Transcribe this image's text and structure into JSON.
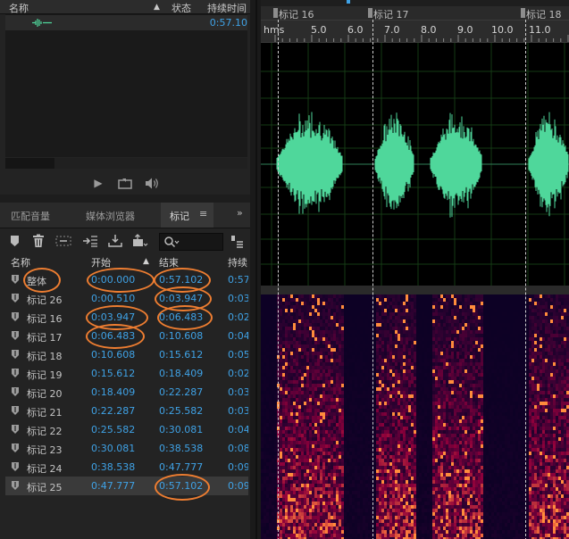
{
  "files_panel": {
    "columns": {
      "name": "名称",
      "status": "状态",
      "duration": "持续时间"
    },
    "file_duration": "0:57.10"
  },
  "markers_panel": {
    "tabs": [
      "匹配音量",
      "媒体浏览器",
      "标记"
    ],
    "active_tab": "标记",
    "columns": {
      "name": "名称",
      "start": "开始",
      "end": "结束",
      "duration": "持续"
    },
    "rows": [
      {
        "name": "整体",
        "start": "0:00.000",
        "end": "0:57.102",
        "duration": "0:57"
      },
      {
        "name": "标记 26",
        "start": "0:00.510",
        "end": "0:03.947",
        "duration": "0:03"
      },
      {
        "name": "标记 16",
        "start": "0:03.947",
        "end": "0:06.483",
        "duration": "0:02"
      },
      {
        "name": "标记 17",
        "start": "0:06.483",
        "end": "0:10.608",
        "duration": "0:04"
      },
      {
        "name": "标记 18",
        "start": "0:10.608",
        "end": "0:15.612",
        "duration": "0:05"
      },
      {
        "name": "标记 19",
        "start": "0:15.612",
        "end": "0:18.409",
        "duration": "0:02"
      },
      {
        "name": "标记 20",
        "start": "0:18.409",
        "end": "0:22.287",
        "duration": "0:03"
      },
      {
        "name": "标记 21",
        "start": "0:22.287",
        "end": "0:25.582",
        "duration": "0:03"
      },
      {
        "name": "标记 22",
        "start": "0:25.582",
        "end": "0:30.081",
        "duration": "0:04"
      },
      {
        "name": "标记 23",
        "start": "0:30.081",
        "end": "0:38.538",
        "duration": "0:08"
      },
      {
        "name": "标记 24",
        "start": "0:38.538",
        "end": "0:47.777",
        "duration": "0:09"
      },
      {
        "name": "标记 25",
        "start": "0:47.777",
        "end": "0:57.102",
        "duration": "0:09"
      }
    ]
  },
  "editor": {
    "markers": [
      "标记 16",
      "标记 17",
      "标记 18"
    ],
    "ruler_unit": "hms",
    "ruler_ticks": [
      "5.0",
      "6.0",
      "7.0",
      "8.0",
      "9.0",
      "10.0",
      "11.0"
    ]
  },
  "colors": {
    "accent_blue": "#3fa2e6",
    "waveform": "#4fd79b",
    "annotation": "#ed7d31"
  }
}
